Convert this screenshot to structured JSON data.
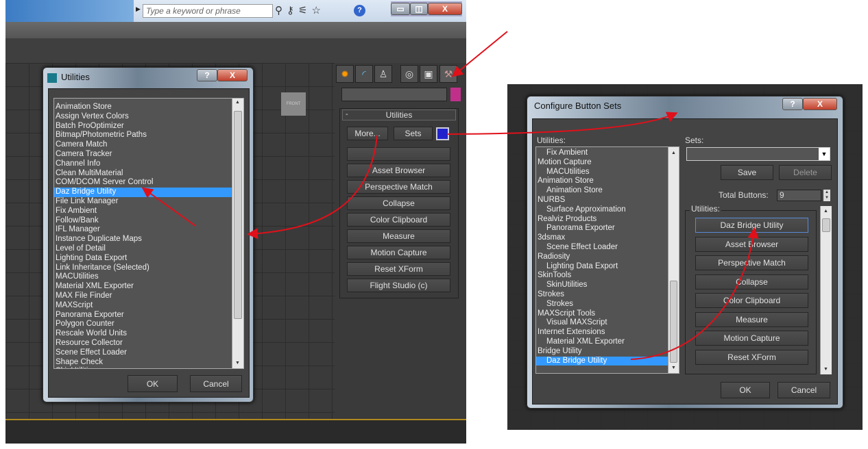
{
  "left_app": {
    "search_placeholder": "Type a keyword or phrase",
    "toolbar_icons": [
      "binoculars-icon",
      "key-icon",
      "satellite-icon",
      "star-icon",
      "help-icon"
    ],
    "window_buttons": [
      "minimize",
      "restore",
      "close"
    ],
    "viewport_label": "FRONT",
    "command_tabs": [
      "create",
      "modify",
      "hierarchy",
      "motion",
      "display",
      "utilities"
    ],
    "accent_color": "#c0308a",
    "rollout_title": "Utilities",
    "rollout_toggle": "-",
    "more_label": "More...",
    "sets_label": "Sets",
    "buttons": [
      "",
      "Asset Browser",
      "Perspective Match",
      "Collapse",
      "Color Clipboard",
      "Measure",
      "Motion Capture",
      "Reset XForm",
      "Flight Studio (c)"
    ]
  },
  "utilities_dialog": {
    "title": "Utilities",
    "help": "?",
    "close": "X",
    "items": [
      "Animation Store",
      "Assign Vertex Colors",
      "Batch ProOptimizer",
      "Bitmap/Photometric Paths",
      "Camera Match",
      "Camera Tracker",
      "Channel Info",
      "Clean MultiMaterial",
      "COM/DCOM Server Control",
      "Daz Bridge Utility",
      "File Link Manager",
      "Fix Ambient",
      "Follow/Bank",
      "IFL Manager",
      "Instance Duplicate Maps",
      "Level of Detail",
      "Lighting Data Export",
      "Link Inheritance (Selected)",
      "MACUtilities",
      "Material XML Exporter",
      "MAX File Finder",
      "MAXScript",
      "Panorama Exporter",
      "Polygon Counter",
      "Rescale World Units",
      "Resource Collector",
      "Scene Effect Loader",
      "Shape Check",
      "SkinUtilities"
    ],
    "selected": "Daz Bridge Utility",
    "ok": "OK",
    "cancel": "Cancel"
  },
  "configure_dialog": {
    "title": "Configure Button Sets",
    "help": "?",
    "close": "X",
    "utilities_label": "Utilities:",
    "tree": [
      {
        "label": "Fix Ambient",
        "sub": true
      },
      {
        "label": "Motion Capture",
        "sub": false
      },
      {
        "label": "MACUtilities",
        "sub": true
      },
      {
        "label": "Animation Store",
        "sub": false
      },
      {
        "label": "Animation Store",
        "sub": true
      },
      {
        "label": "NURBS",
        "sub": false
      },
      {
        "label": "Surface Approximation",
        "sub": true
      },
      {
        "label": "Realviz Products",
        "sub": false
      },
      {
        "label": "Panorama Exporter",
        "sub": true
      },
      {
        "label": "3dsmax",
        "sub": false
      },
      {
        "label": "Scene Effect Loader",
        "sub": true
      },
      {
        "label": "Radiosity",
        "sub": false
      },
      {
        "label": "Lighting Data Export",
        "sub": true
      },
      {
        "label": "SkinTools",
        "sub": false
      },
      {
        "label": "SkinUtilities",
        "sub": true
      },
      {
        "label": "Strokes",
        "sub": false
      },
      {
        "label": "Strokes",
        "sub": true
      },
      {
        "label": "MAXScript Tools",
        "sub": false
      },
      {
        "label": "Visual MAXScript",
        "sub": true
      },
      {
        "label": "Internet Extensions",
        "sub": false
      },
      {
        "label": "Material XML Exporter",
        "sub": true
      },
      {
        "label": "Bridge Utility",
        "sub": false
      },
      {
        "label": "Daz Bridge Utility",
        "sub": true,
        "selected": true
      }
    ],
    "sets_label": "Sets:",
    "sets_value": "",
    "save": "Save",
    "delete": "Delete",
    "total_buttons_label": "Total Buttons:",
    "total_buttons": "9",
    "group_label": "Utilities:",
    "buttons": [
      "Daz Bridge Utility",
      "Asset Browser",
      "Perspective Match",
      "Collapse",
      "Color Clipboard",
      "Measure",
      "Motion Capture",
      "Reset XForm"
    ],
    "ok": "OK",
    "cancel": "Cancel"
  },
  "annotation_color": "#e0101a"
}
